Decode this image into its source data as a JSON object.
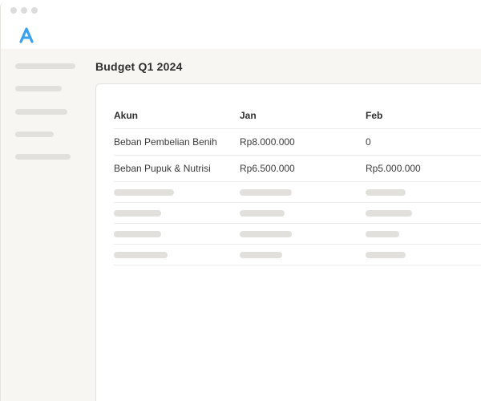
{
  "page": {
    "title": "Budget Q1 2024"
  },
  "colors": {
    "accent": "#3aa0f0",
    "background": "#f7f6f3",
    "skeleton": "#e2e0dc"
  },
  "logo": {
    "icon": "app-logo-icon"
  },
  "table": {
    "columns": [
      "Akun",
      "Jan",
      "Feb"
    ],
    "rows": [
      {
        "account": "Beban Pembelian Benih",
        "jan": "Rp8.000.000",
        "feb": "0"
      },
      {
        "account": "Beban Pupuk & Nutrisi",
        "jan": "Rp6.500.000",
        "feb": "Rp5.000.000"
      }
    ]
  }
}
